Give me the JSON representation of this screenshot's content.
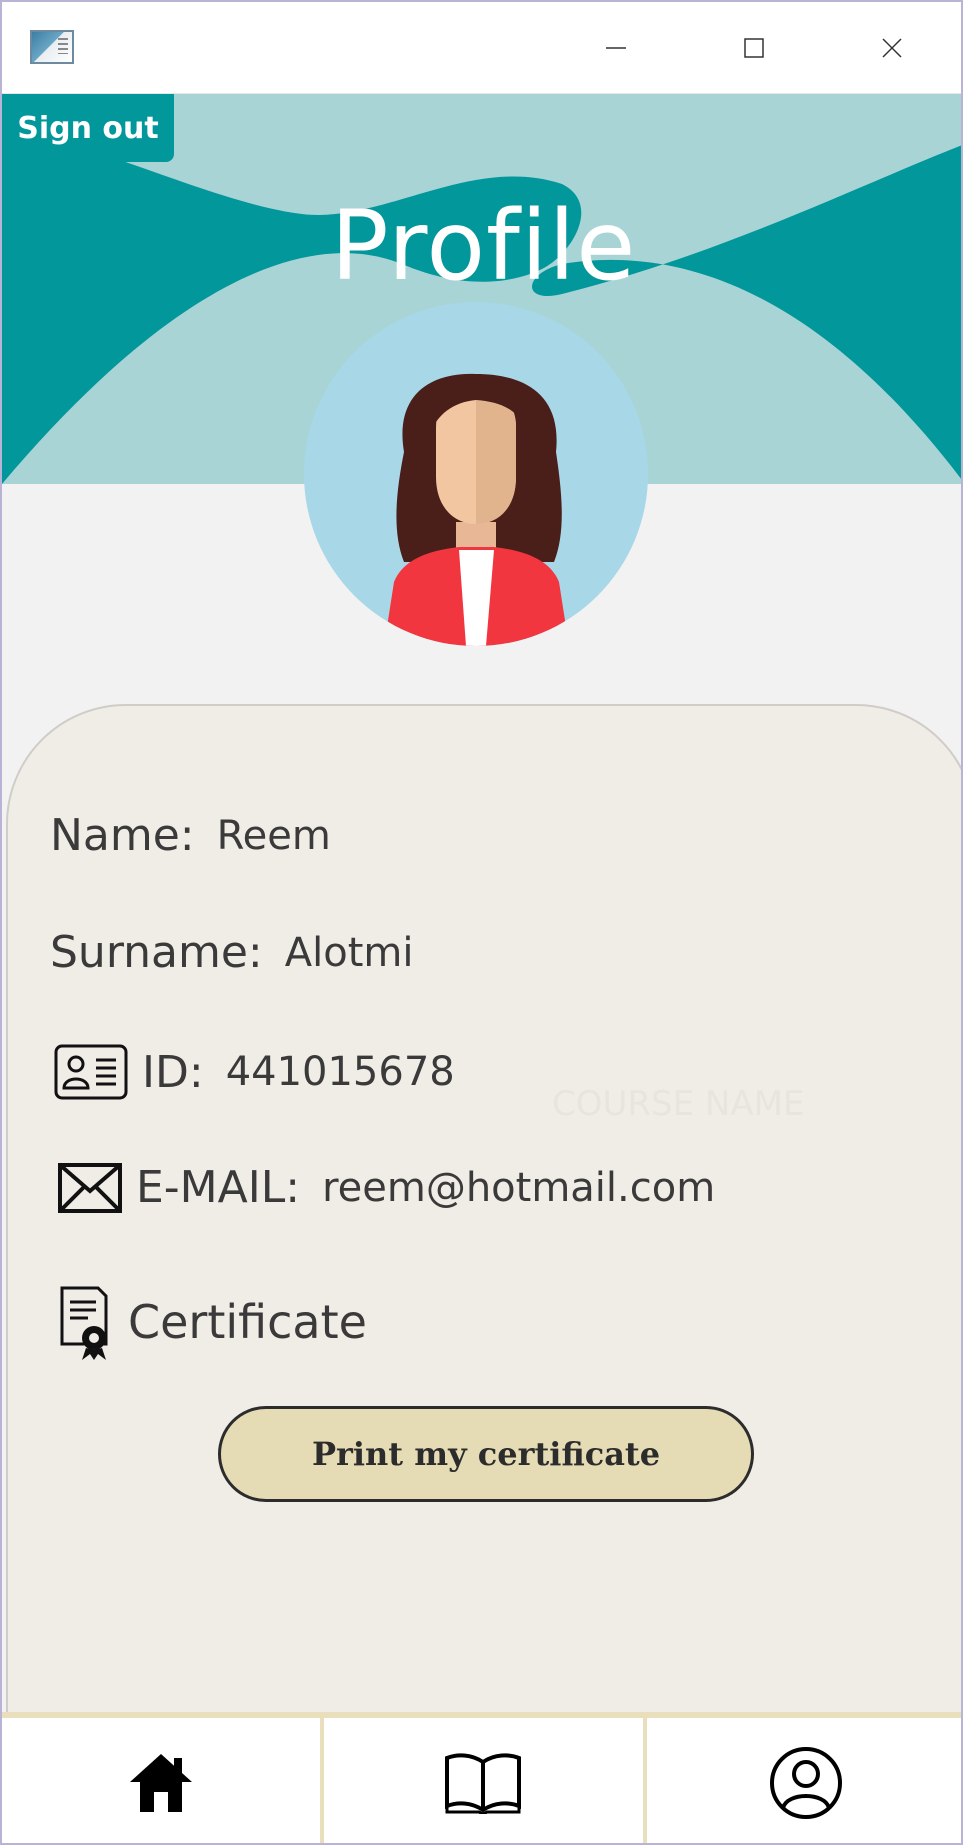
{
  "window": {
    "app_icon": "app-window-icon",
    "controls": [
      "minimize-icon",
      "maximize-icon",
      "close-icon"
    ]
  },
  "header": {
    "sign_out_label": "Sign out",
    "title": "Profile"
  },
  "profile": {
    "name_label": "Name:",
    "name_value": "Reem",
    "surname_label": "Surname:",
    "surname_value": "Alotmi",
    "id_label": "ID:",
    "id_value": "441015678",
    "email_label": "E-MAIL:",
    "email_value": "reem@hotmail.com",
    "certificate_label": "Certificate",
    "ghost_text": "COURSE NAME"
  },
  "actions": {
    "print_label": "Print my certificate"
  },
  "nav": {
    "items": [
      "home-icon",
      "book-icon",
      "user-profile-icon"
    ]
  },
  "colors": {
    "teal": "#02979b",
    "light_teal": "#a9d4d6",
    "card_bg": "#f0ece6",
    "button_bg": "#e5dcb5",
    "nav_divider": "#e9dfbd"
  }
}
